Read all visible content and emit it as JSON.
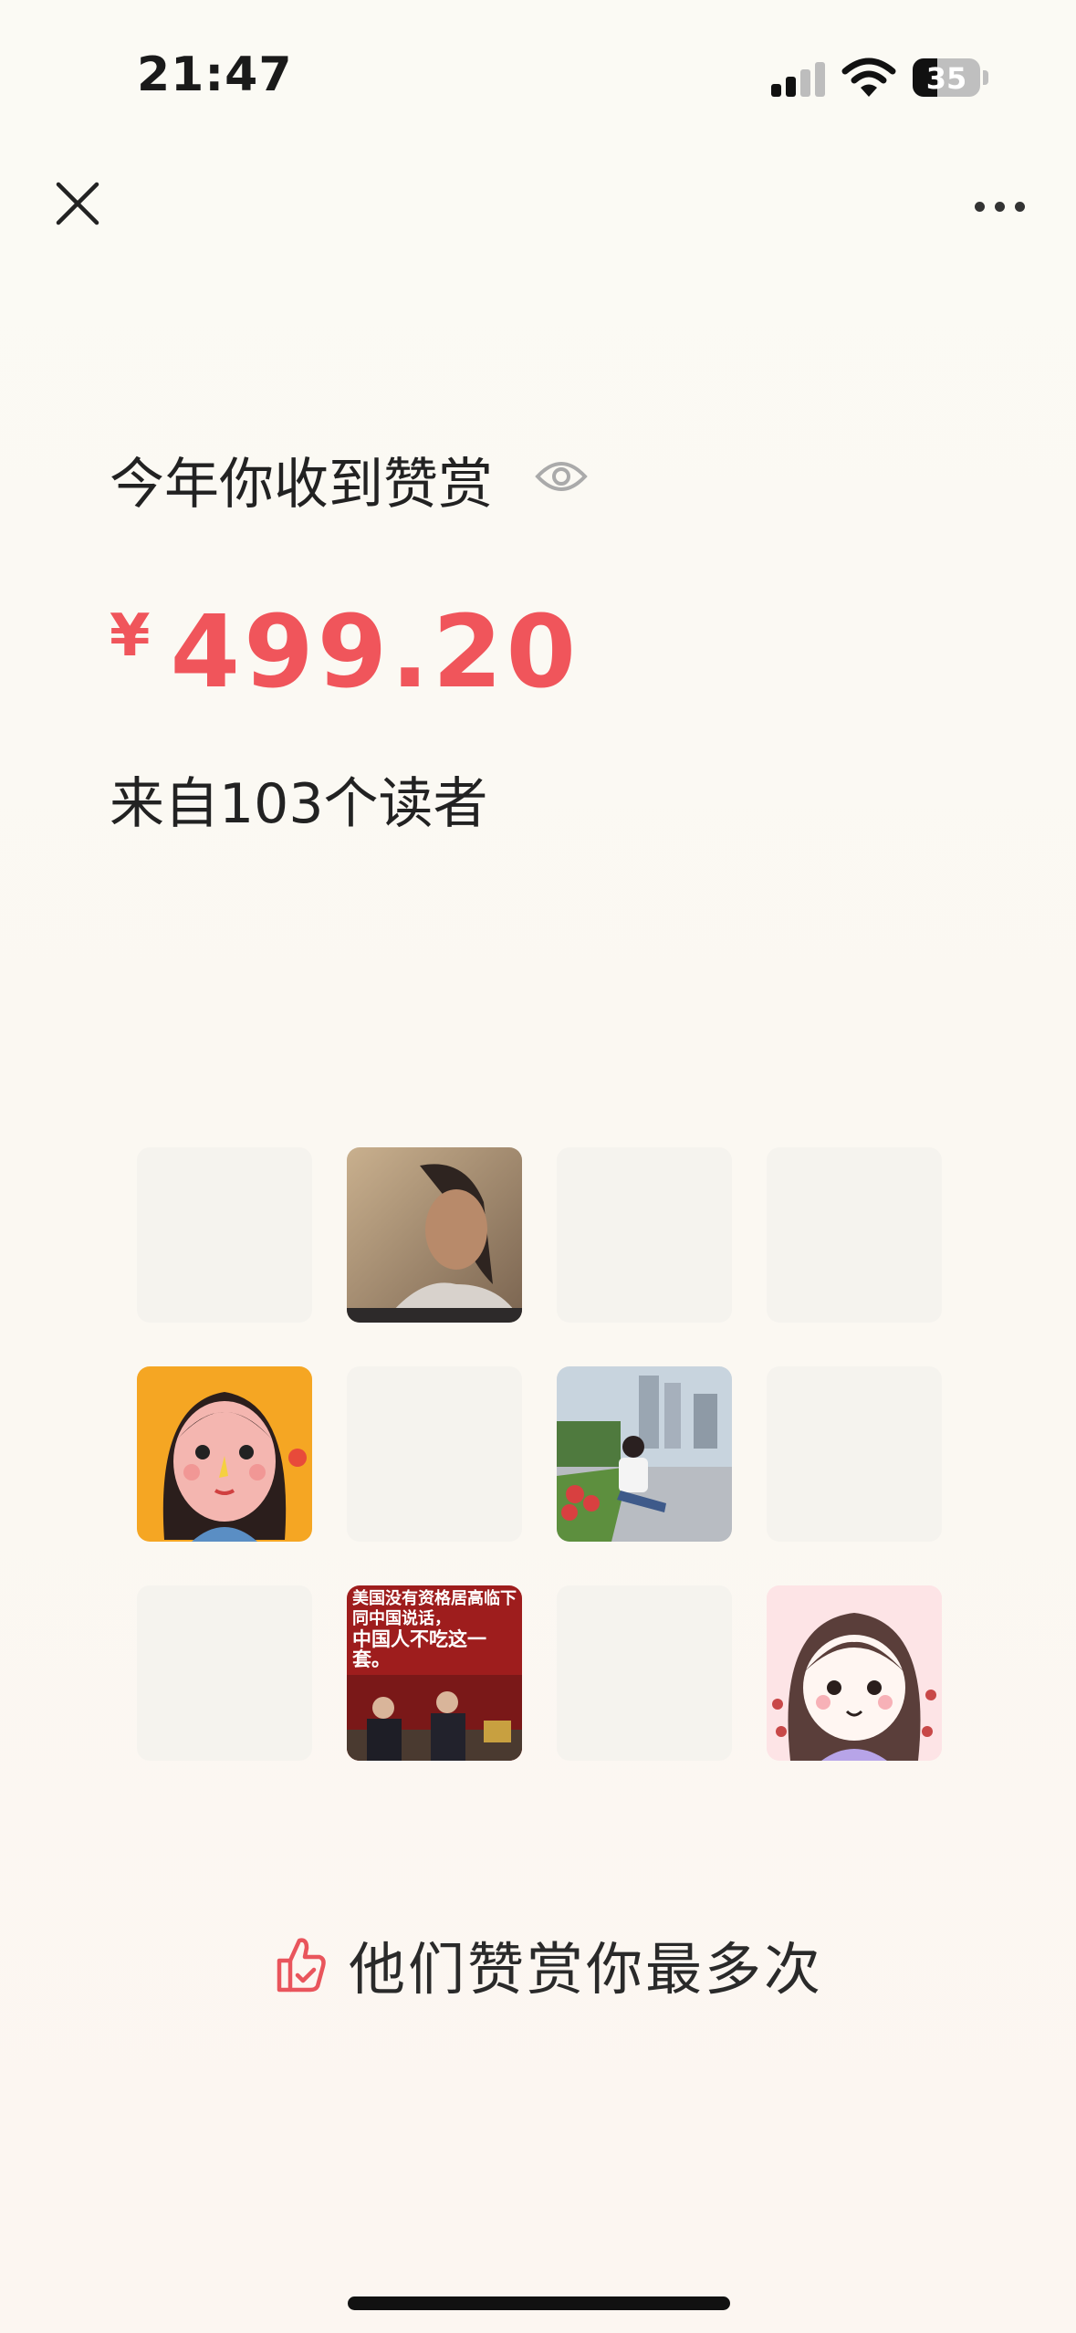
{
  "status_bar": {
    "time": "21:47",
    "battery": "35",
    "signal_bars_active": 2,
    "signal_bars_total": 4
  },
  "nav": {
    "close_icon": "close-icon",
    "more_icon": "more-horizontal-icon"
  },
  "summary": {
    "title": "今年你收到赞赏",
    "visibility_icon": "eye-icon",
    "currency": "¥",
    "amount": "499.20",
    "readers_prefix": "来自",
    "readers_count": "103",
    "readers_suffix": "个读者"
  },
  "top_supporters": {
    "grid_rows": 3,
    "grid_cols": 4,
    "avatars": [
      {
        "slot": 1,
        "kind": "photo-woman-portrait"
      },
      {
        "slot": 4,
        "kind": "cartoon-girl-orange"
      },
      {
        "slot": 6,
        "kind": "photo-woman-park"
      },
      {
        "slot": 9,
        "kind": "news-image"
      },
      {
        "slot": 11,
        "kind": "cartoon-girl-pink"
      }
    ],
    "news_image_text": {
      "line1": "美国没有资格居高临下",
      "line2": "同中国说话，",
      "line3": "中国人不吃这一套。"
    },
    "label": "他们赞赏你最多次",
    "label_icon": "thumbs-up-icon"
  },
  "colors": {
    "accent_red": "#f0555b",
    "background": "#fbf9f3",
    "empty_tile": "#f5f3ee"
  }
}
